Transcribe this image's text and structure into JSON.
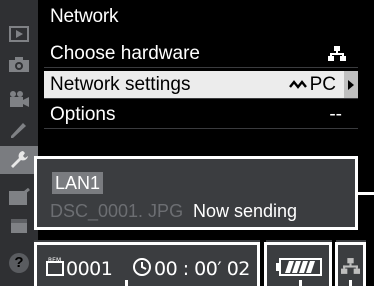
{
  "menu": {
    "title": "Network",
    "items": [
      {
        "label": "Choose hardware",
        "value_icon": "network-icon"
      },
      {
        "label": "Network settings",
        "value": "PC",
        "value_icon": "connection-icon"
      },
      {
        "label": "Options",
        "value": "--"
      }
    ]
  },
  "status": {
    "profile": "LAN1",
    "file": "DSC_0001. JPG",
    "message": "Now sending",
    "remaining_count": "0001",
    "time_remaining": "00 : 00′ 02"
  },
  "tabs": [
    {
      "icon": "playback-icon"
    },
    {
      "icon": "camera-icon"
    },
    {
      "icon": "movie-icon"
    },
    {
      "icon": "pencil-icon"
    },
    {
      "icon": "wrench-icon",
      "active": true
    },
    {
      "icon": "retouch-icon"
    },
    {
      "icon": "my-menu-icon"
    },
    {
      "icon": "help-icon",
      "glyph": "?"
    }
  ],
  "colors": {
    "highlight": "#ececec",
    "panel": "#3b3d40",
    "tab_strip": "#2f3033",
    "battery": "#ffffff"
  }
}
